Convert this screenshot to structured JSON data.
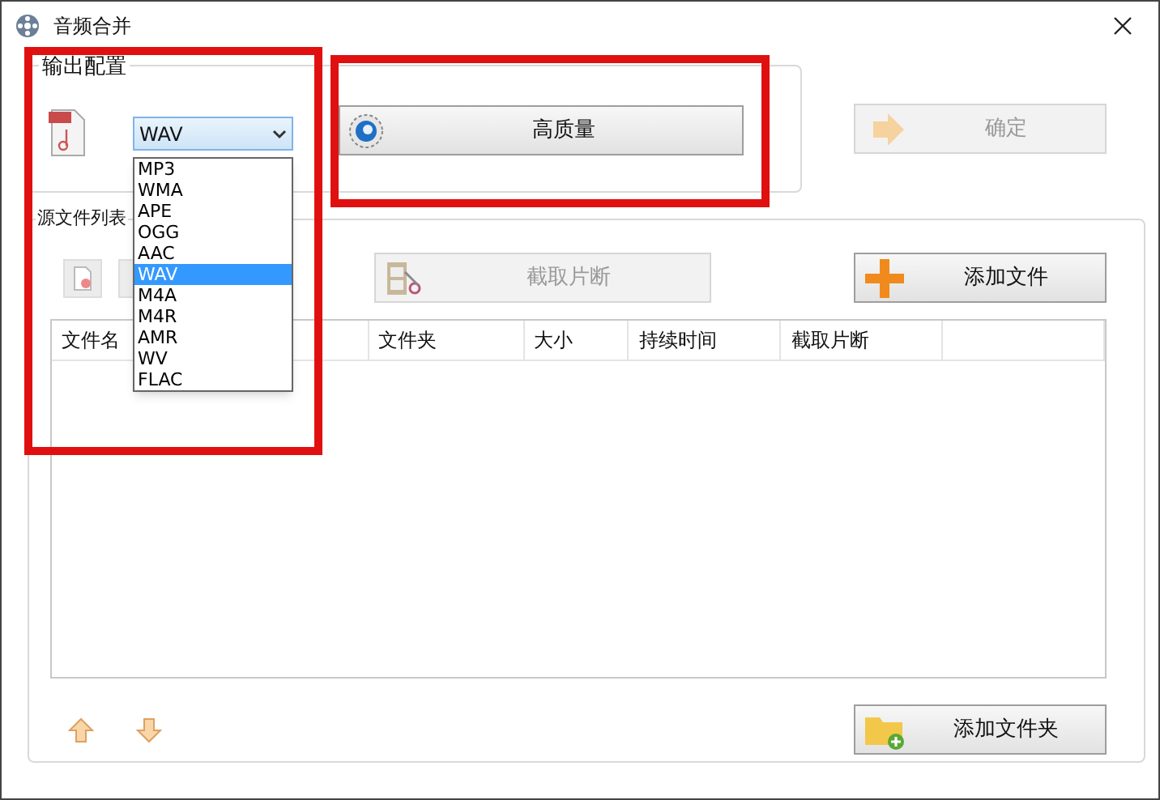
{
  "window": {
    "title": "音频合并"
  },
  "output_config": {
    "title": "输出配置",
    "format": {
      "value": "WAV",
      "options": [
        {
          "label": "MP3",
          "selected": false
        },
        {
          "label": "WMA",
          "selected": false
        },
        {
          "label": "APE",
          "selected": false
        },
        {
          "label": "OGG",
          "selected": false
        },
        {
          "label": "AAC",
          "selected": false
        },
        {
          "label": "WAV",
          "selected": true
        },
        {
          "label": "M4A",
          "selected": false
        },
        {
          "label": "M4R",
          "selected": false
        },
        {
          "label": "AMR",
          "selected": false
        },
        {
          "label": "WV",
          "selected": false
        },
        {
          "label": "FLAC",
          "selected": false
        }
      ]
    },
    "quality_button": {
      "label": "高质量",
      "disabled": false
    },
    "ok_button": {
      "label": "确定",
      "disabled": true
    }
  },
  "source_list": {
    "title": "源文件列表",
    "clip_button": {
      "label": "截取片断",
      "disabled": true
    },
    "add_file_button": {
      "label": "添加文件",
      "disabled": false
    },
    "table": {
      "columns": [
        "文件名",
        "文件夹",
        "大小",
        "持续时间",
        "截取片断"
      ]
    },
    "add_folder_button": {
      "label": "添加文件夹",
      "disabled": false
    }
  }
}
